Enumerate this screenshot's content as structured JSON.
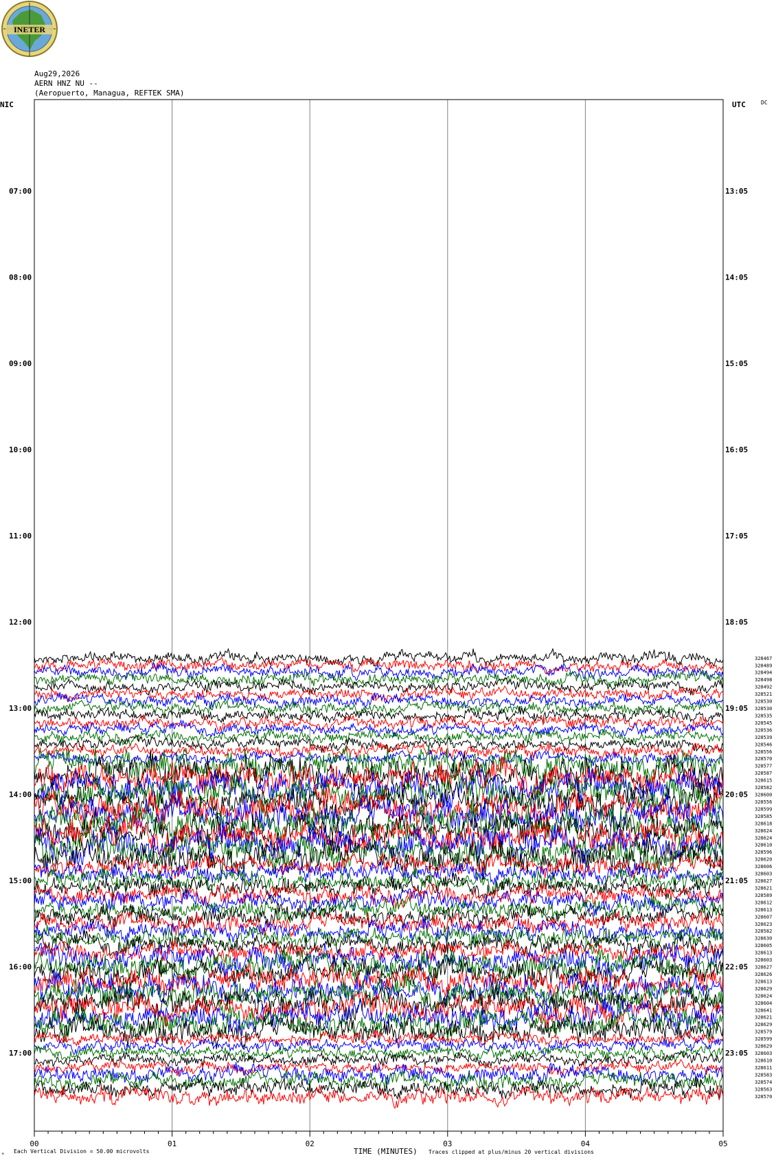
{
  "header": {
    "logo_text": "INETER",
    "date": "Aug29,2026",
    "station": "AERN HNZ NU --",
    "location": "(Aeropuerto, Managua, REFTEK SMA)"
  },
  "left_axis_title": "NIC",
  "right_axis_title": "UTC",
  "right_corner_label": "DC",
  "footer": {
    "left_note_mark": "*",
    "scale_note": "Each Vertical Division =    50.00 microvolts",
    "xlabel": "TIME (MINUTES)",
    "clip_note": "Traces clipped at plus/minus 20 vertical divisions"
  },
  "chart_data": {
    "type": "line",
    "title": "AERN HNZ NU --",
    "xlabel": "TIME (MINUTES)",
    "x_ticks": [
      "00",
      "01",
      "02",
      "03",
      "04",
      "05"
    ],
    "xlim": [
      0,
      5
    ],
    "left_hour_labels": [
      "07:00",
      "08:00",
      "09:00",
      "10:00",
      "11:00",
      "12:00",
      "13:00",
      "14:00",
      "15:00",
      "16:00",
      "17:00"
    ],
    "right_hour_labels": [
      "13:05",
      "14:05",
      "15:05",
      "16:05",
      "17:05",
      "18:05",
      "19:05",
      "20:05",
      "21:05",
      "22:05",
      "23:05"
    ],
    "trace_colors": [
      "#000000",
      "#ff0000",
      "#0000ff",
      "#007000"
    ],
    "traces_start": "12:25",
    "trace_interval_minutes": 5,
    "trace_offset_values": [
      "328467",
      "328489",
      "328494",
      "328498",
      "328492",
      "328521",
      "328530",
      "328530",
      "328535",
      "328545",
      "328536",
      "328539",
      "328546",
      "328556",
      "328570",
      "328577",
      "328587",
      "328615",
      "328582",
      "328600",
      "328556",
      "328599",
      "328585",
      "328618",
      "328624",
      "328624",
      "328610",
      "328596",
      "328620",
      "328606",
      "328603",
      "328627",
      "328621",
      "328589",
      "328612",
      "328613",
      "328607",
      "328623",
      "328582",
      "328630",
      "328605",
      "328613",
      "328603",
      "328627",
      "328626",
      "328613",
      "328629",
      "328624",
      "328604",
      "328641",
      "328621",
      "328629",
      "328579",
      "328599",
      "328629",
      "328603",
      "328610",
      "328611",
      "328583",
      "328574",
      "328563",
      "328570"
    ],
    "scale_microvolts_per_division": 50.0,
    "clip_divisions": 20
  }
}
